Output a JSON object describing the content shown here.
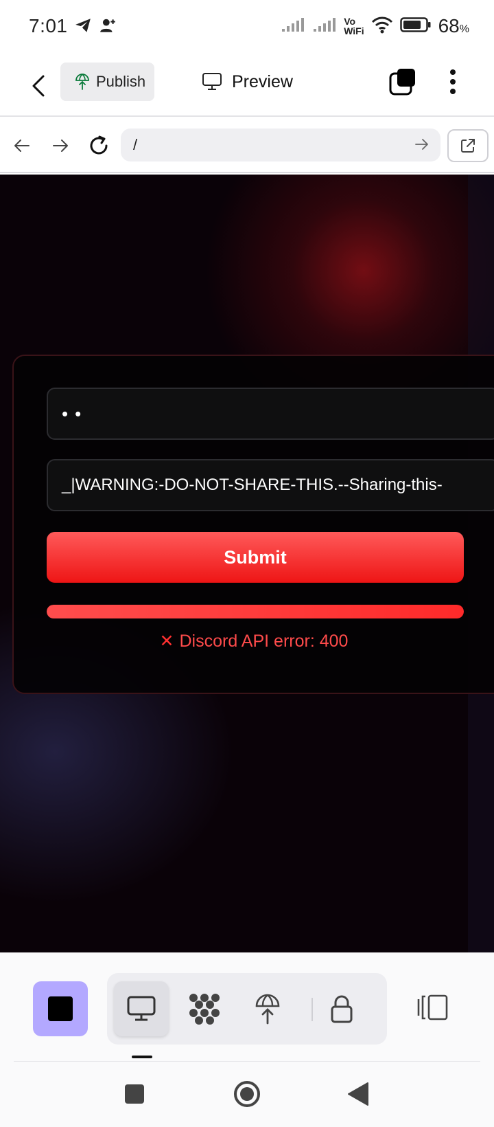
{
  "status_bar": {
    "time": "7:01",
    "battery_percent": "68",
    "battery_symbol": "%",
    "battery_level": 0.68,
    "icons": [
      "telegram-icon",
      "add-contact-icon",
      "signal-icon",
      "signal-icon",
      "vowifi-icon",
      "wifi-icon",
      "battery-icon"
    ],
    "vowifi_top": "Vo",
    "vowifi_bottom": "WiFi"
  },
  "toolbar": {
    "publish_label": "Publish",
    "preview_label": "Preview"
  },
  "browser": {
    "url": "/"
  },
  "form": {
    "password_dots": "••",
    "token_value": "_|WARNING:-DO-NOT-SHARE-THIS.--Sharing-this-",
    "submit_label": "Submit",
    "progress": 1.0,
    "error_icon": "✕",
    "error_text": "Discord API error: 400"
  },
  "dock": {
    "modes": [
      "desktop-icon",
      "apps-grid-icon",
      "publish-icon",
      "lock-icon"
    ],
    "accent": "#b3a8ff"
  },
  "colors": {
    "submit": "#ff2a2a",
    "error": "#ff4b4b",
    "background": "#0a0208"
  }
}
